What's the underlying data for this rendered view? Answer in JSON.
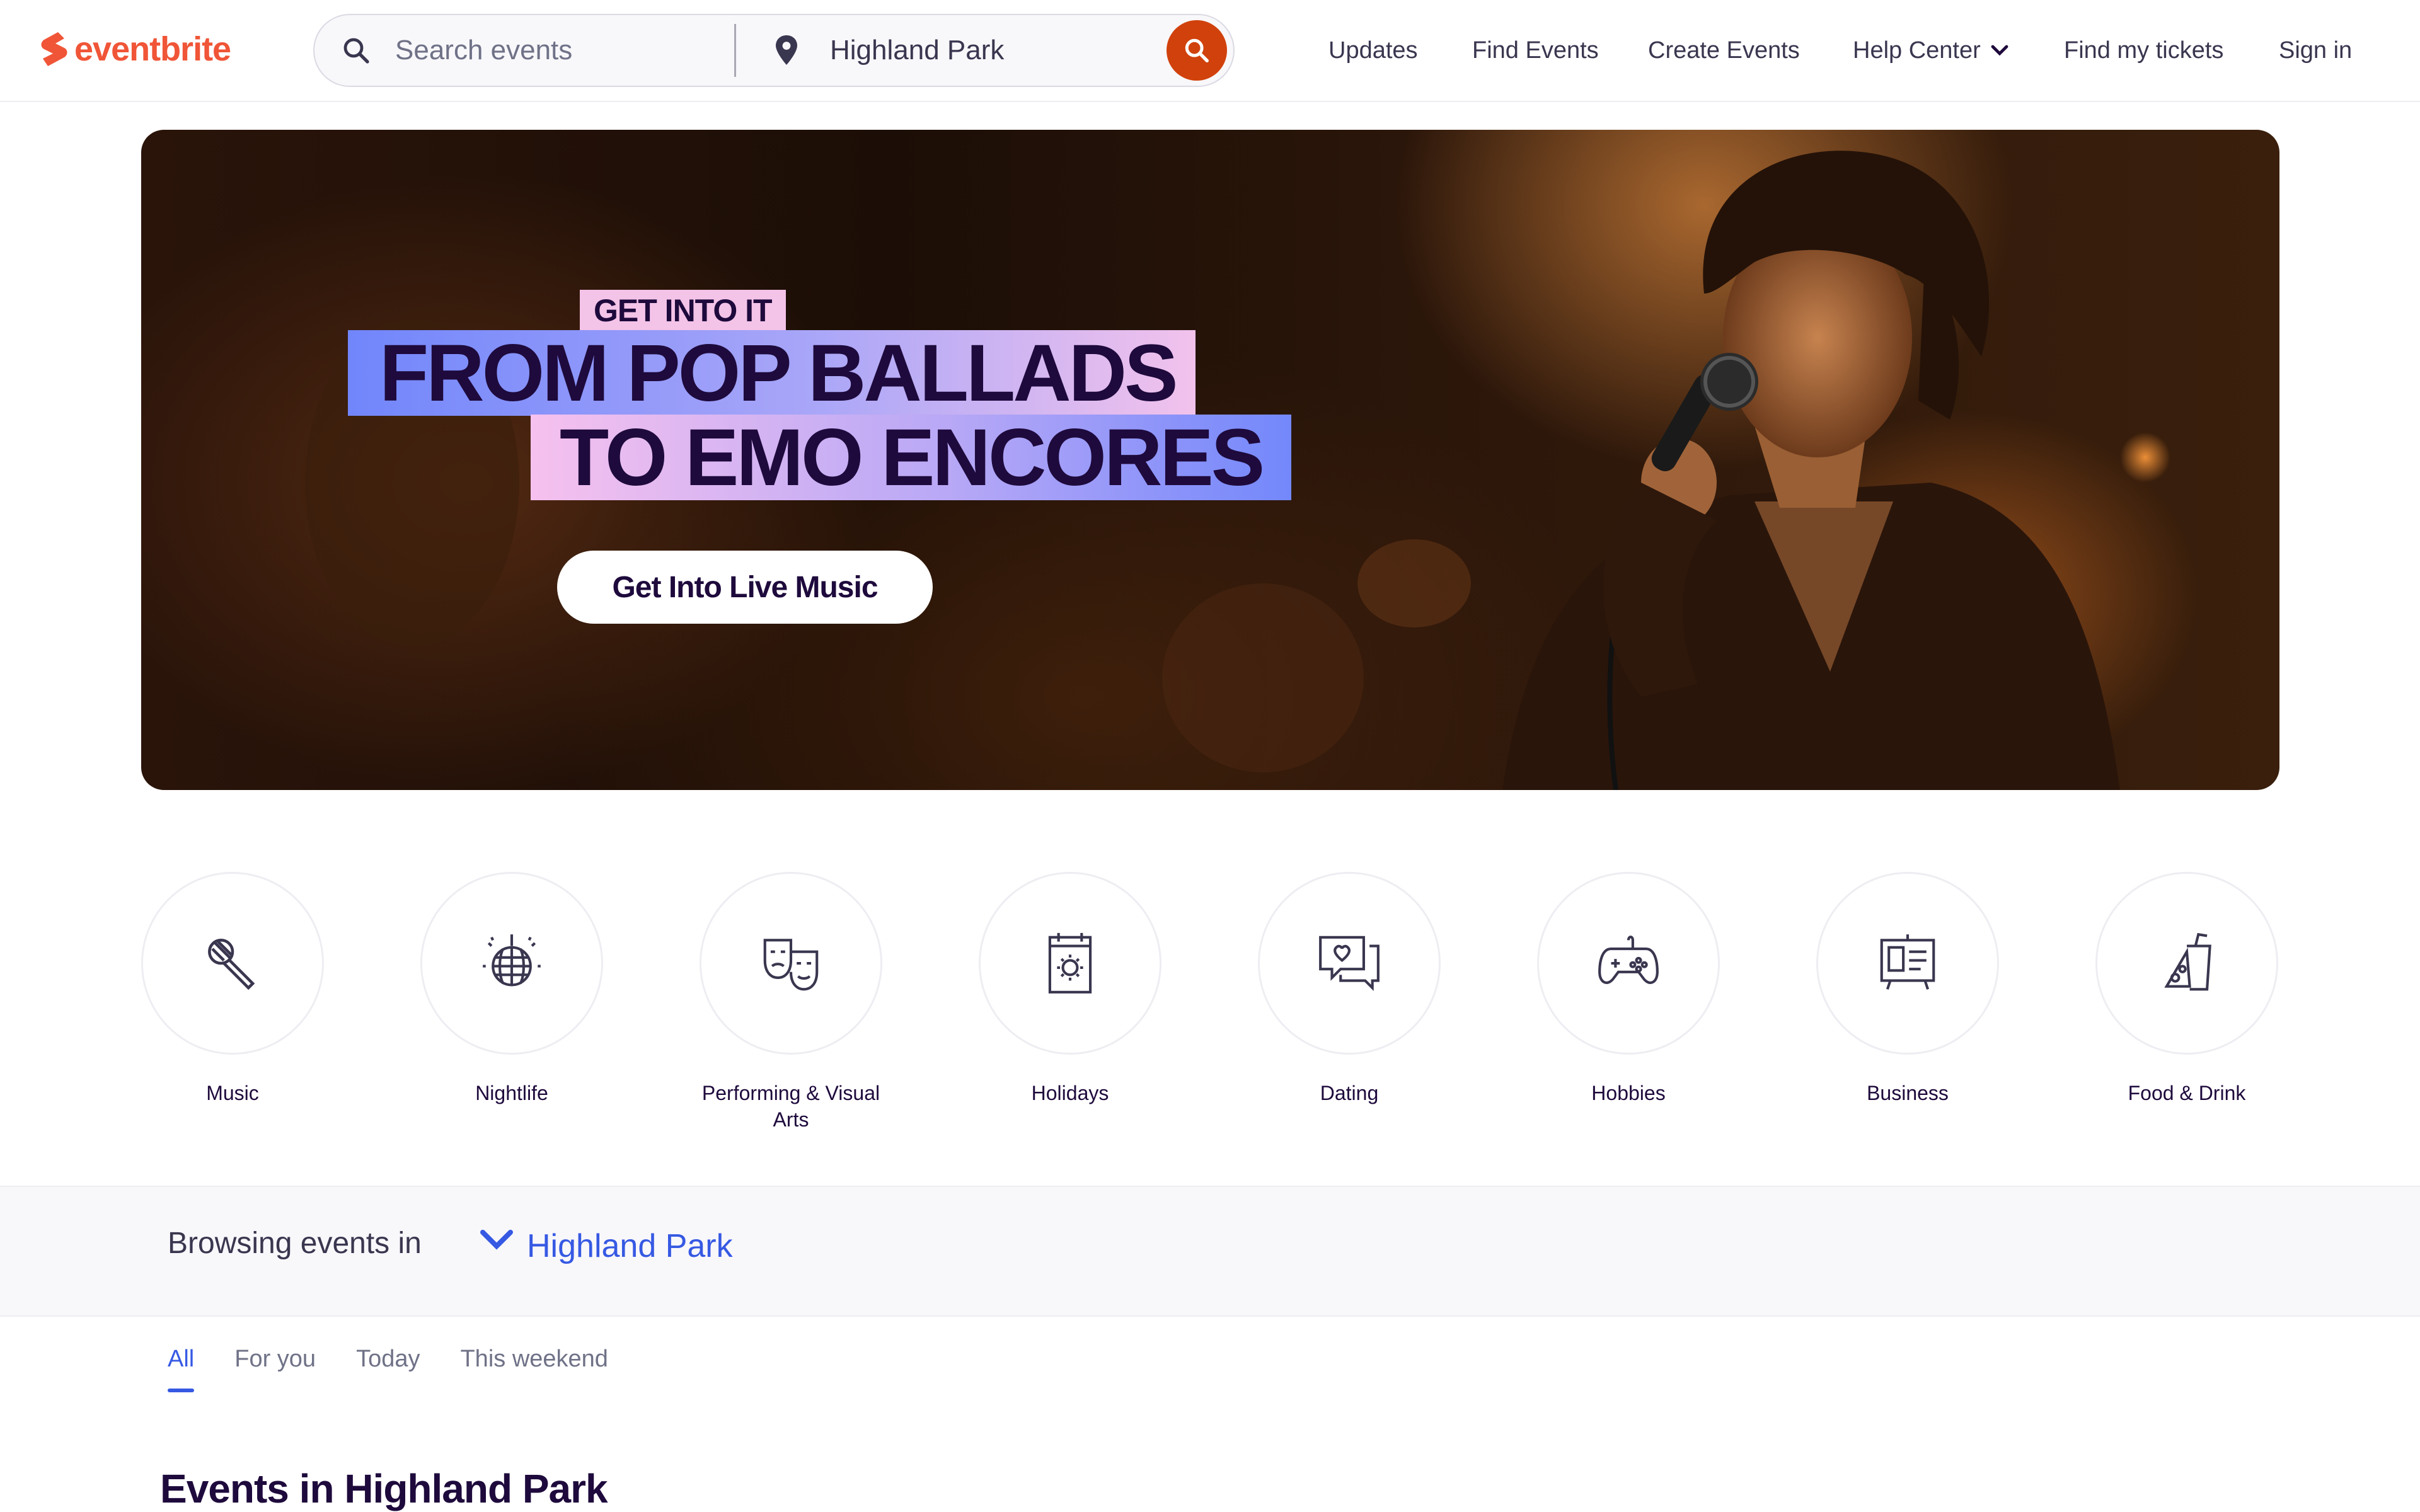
{
  "header": {
    "logo_text": "eventbrite",
    "search_placeholder": "Search events",
    "location_value": "Highland Park",
    "nav": {
      "updates": "Updates",
      "find_events": "Find Events",
      "create_events": "Create Events",
      "help_center": "Help Center",
      "find_tickets": "Find my tickets",
      "sign_in": "Sign in"
    }
  },
  "hero": {
    "tag": "GET INTO IT",
    "line1": "FROM POP BALLADS",
    "line2": "TO EMO ENCORES",
    "cta": "Get Into Live Music"
  },
  "categories": [
    {
      "label": "Music",
      "icon": "microphone-icon"
    },
    {
      "label": "Nightlife",
      "icon": "disco-ball-icon"
    },
    {
      "label": "Performing & Visual Arts",
      "icon": "theater-masks-icon"
    },
    {
      "label": "Holidays",
      "icon": "calendar-sun-icon"
    },
    {
      "label": "Dating",
      "icon": "chat-heart-icon"
    },
    {
      "label": "Hobbies",
      "icon": "gamepad-icon"
    },
    {
      "label": "Business",
      "icon": "presentation-board-icon"
    },
    {
      "label": "Food & Drink",
      "icon": "drink-icon"
    }
  ],
  "browse": {
    "label": "Browsing events in",
    "city": "Highland Park"
  },
  "tabs": [
    {
      "label": "All",
      "active": true
    },
    {
      "label": "For you",
      "active": false
    },
    {
      "label": "Today",
      "active": false
    },
    {
      "label": "This weekend",
      "active": false
    }
  ],
  "section_title": "Events in Highland Park",
  "colors": {
    "brand": "#f05537",
    "search_button": "#d1410c",
    "link_blue": "#3659e3",
    "text_dark": "#1e0a3c"
  }
}
